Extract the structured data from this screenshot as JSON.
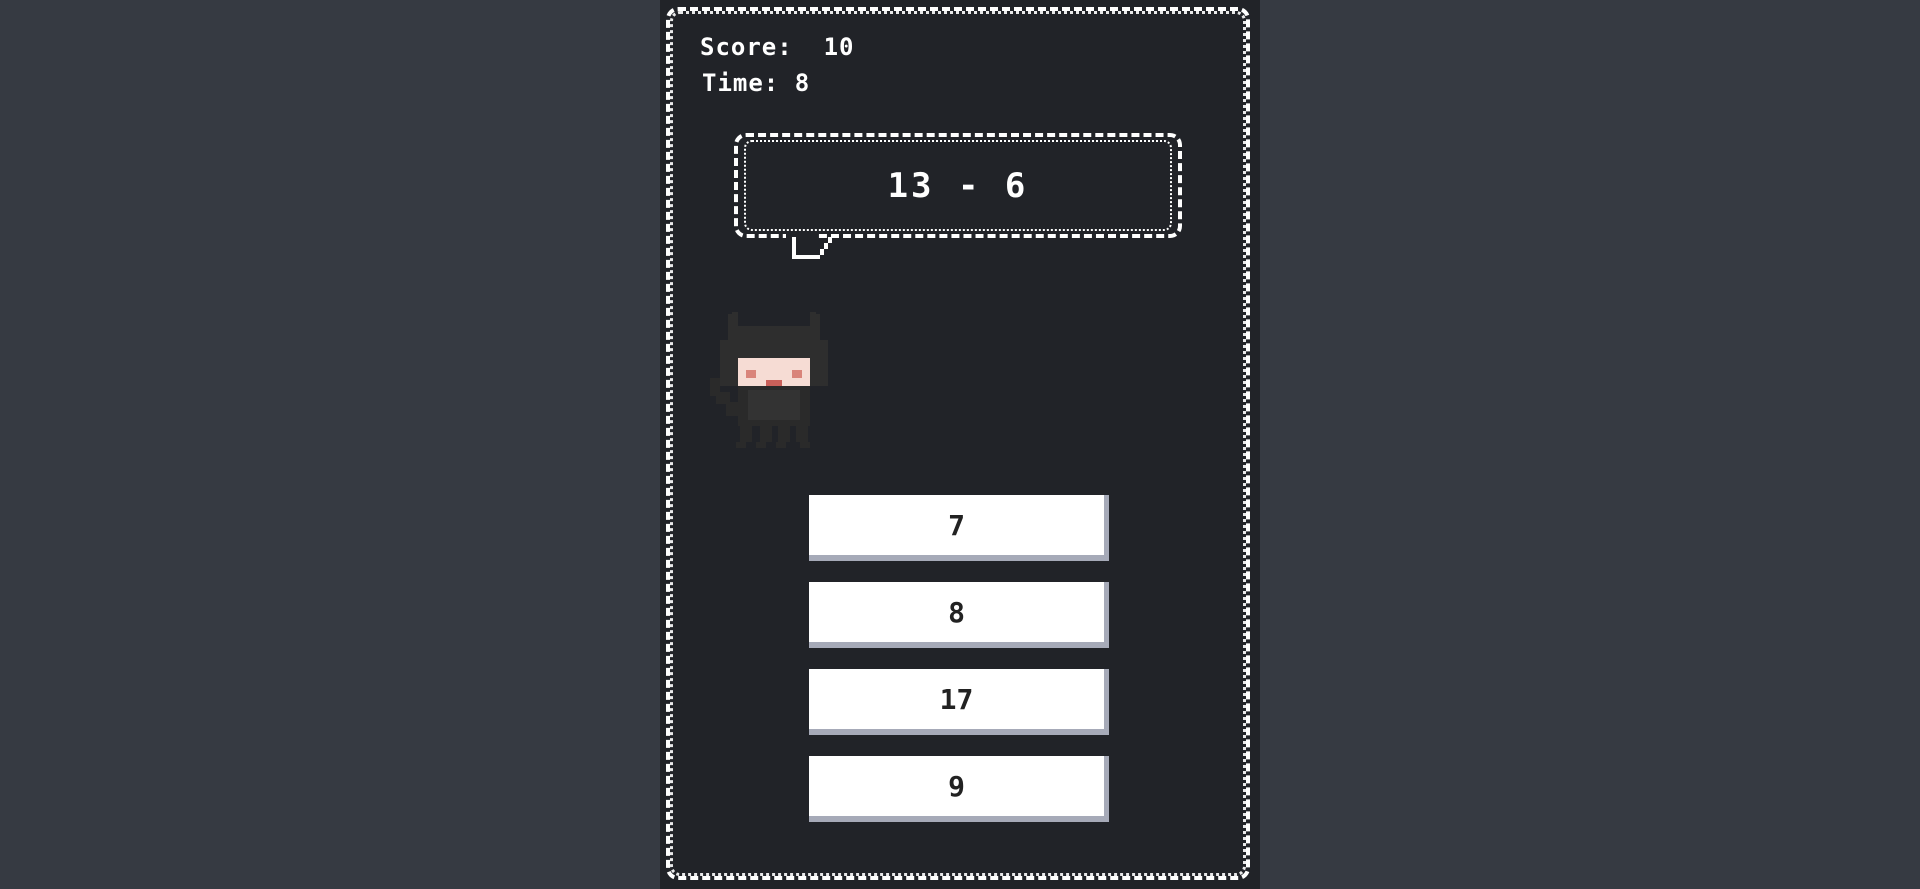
{
  "hud": {
    "score_label": "Score:",
    "score_value": "10",
    "time_label": "Time:",
    "time_value": "8"
  },
  "question": {
    "text": "13 - 6"
  },
  "answers": [
    {
      "label": "7"
    },
    {
      "label": "8"
    },
    {
      "label": "17"
    },
    {
      "label": "9"
    }
  ],
  "colors": {
    "page_background": "#363a42",
    "game_background": "#212328",
    "frame": "#ffffff",
    "button_face": "#ffffff",
    "button_shadow": "#a6aab8",
    "button_text": "#222222"
  },
  "icons": {
    "character": "pixel-cat-hood-character-icon",
    "bubble_tail": "speech-bubble-tail-icon"
  }
}
